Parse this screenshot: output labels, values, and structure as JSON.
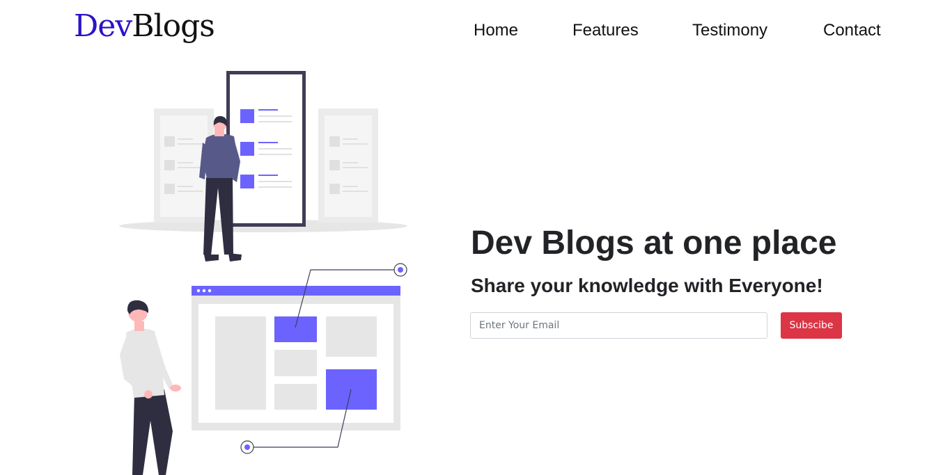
{
  "header": {
    "logo": {
      "part1": "Dev",
      "part2": "Blogs"
    },
    "nav": [
      {
        "label": "Home"
      },
      {
        "label": "Features"
      },
      {
        "label": "Testimony"
      },
      {
        "label": "Contact"
      }
    ]
  },
  "hero": {
    "title": "Dev Blogs at one place",
    "subtitle": "Share your knowledge with Everyone!",
    "email_placeholder": "Enter Your Email",
    "subscribe_label": "Subscibe"
  },
  "colors": {
    "accent": "#6c63ff",
    "logo_dev": "#2a14c8",
    "button": "#dc3545"
  }
}
